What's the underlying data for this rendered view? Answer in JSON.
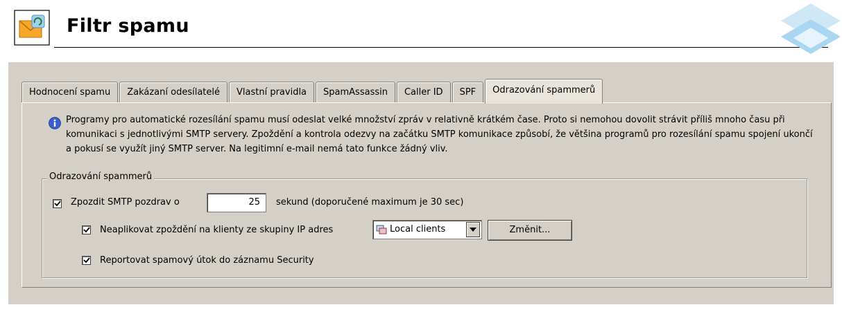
{
  "header": {
    "title": "Filtr spamu"
  },
  "tabs": [
    {
      "label": "Hodnocení spamu"
    },
    {
      "label": "Zakázaní odesílatelé"
    },
    {
      "label": "Vlastní pravidla"
    },
    {
      "label": "SpamAssassin"
    },
    {
      "label": "Caller ID"
    },
    {
      "label": "SPF"
    },
    {
      "label": "Odrazování spammerů",
      "active": true
    }
  ],
  "info": {
    "icon": "info-icon",
    "text": "Programy pro automatické rozesílání spamu musí odeslat velké množství zpráv v relativně krátkém čase. Proto si nemohou dovolit strávit příliš mnoho času při komunikaci s jednotlivými SMTP servery. Zpoždění a kontrola odezvy na začátku SMTP komunikace způsobí, že většina programů pro rozesílání spamu spojení ukončí a pokusí se využít jiný SMTP server. Na legitimní e-mail nemá tato funkce žádný vliv."
  },
  "group": {
    "legend": "Odrazování spammerů",
    "delay": {
      "checked": true,
      "label": "Zpozdit SMTP pozdrav o",
      "value": "25",
      "suffix": "sekund (doporučené maximum je 30 sec)"
    },
    "exclude": {
      "checked": true,
      "label": "Neaplikovat zpoždění na klienty ze skupiny IP adres",
      "selected": "Local clients",
      "button": "Změnit..."
    },
    "report": {
      "checked": true,
      "label": "Reportovat spamový útok do záznamu Security"
    }
  }
}
